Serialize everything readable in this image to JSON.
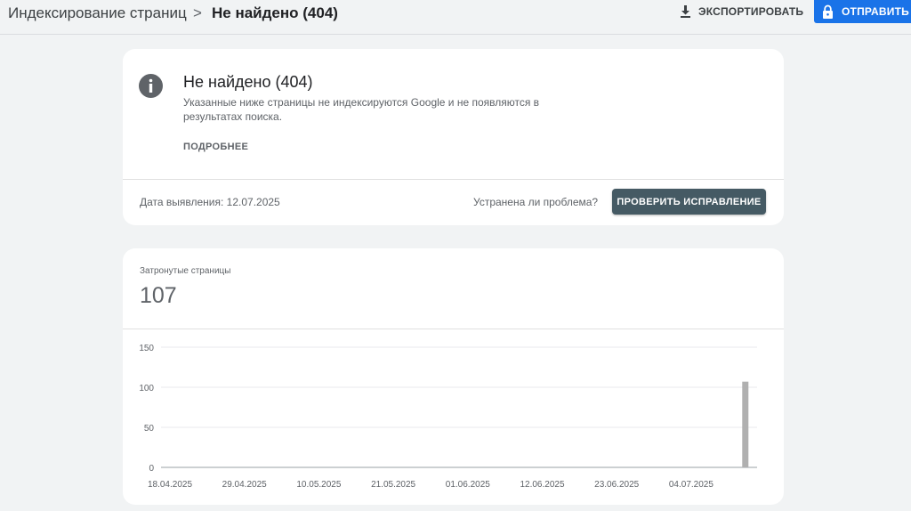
{
  "header": {
    "breadcrumb_root": "Индексирование страниц",
    "breadcrumb_separator": ">",
    "breadcrumb_current": "Не найдено (404)",
    "export_label": "ЭКСПОРТИРОВАТЬ",
    "submit_label": "ОТПРАВИТЬ",
    "export_icon": "download-icon",
    "submit_icon": "lock-icon",
    "accent_color": "#1a73e8"
  },
  "issue": {
    "icon": "info-icon",
    "title": "Не найдено (404)",
    "description": "Указанные ниже страницы не индексируются Google и не появляются в результатах поиска.",
    "more_label": "ПОДРОБНЕЕ",
    "detected_date": "Дата выявления: 12.07.2025",
    "fixed_question": "Устранена ли проблема?",
    "validate_label": "ПРОВЕРИТЬ ИСПРАВЛЕНИЕ",
    "validate_color": "#455a64"
  },
  "affected": {
    "label": "Затронутые страницы",
    "count": "107"
  },
  "chart_data": {
    "type": "bar",
    "x_tick_labels": [
      "18.04.2025",
      "29.04.2025",
      "10.05.2025",
      "21.05.2025",
      "01.06.2025",
      "12.06.2025",
      "23.06.2025",
      "04.07.2025"
    ],
    "y_ticks": [
      0,
      50,
      100,
      150
    ],
    "ylim": [
      0,
      150
    ],
    "x_range": [
      "18.04.2025",
      "12.07.2025"
    ],
    "bars": [
      {
        "date": "12.07.2025",
        "value": 107
      }
    ],
    "bar_color": "#b0b0b0",
    "grid": true,
    "legend": "none"
  }
}
